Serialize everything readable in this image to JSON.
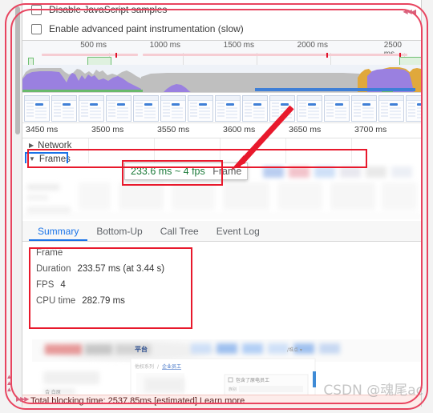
{
  "settings": {
    "checkboxes": [
      {
        "label": "Disable JavaScript samples",
        "checked": false
      },
      {
        "label": "Enable advanced paint instrumentation (slow)",
        "checked": false
      }
    ]
  },
  "overview": {
    "ticks": [
      "500 ms",
      "1000 ms",
      "1500 ms",
      "2000 ms",
      "2500 ms"
    ]
  },
  "timeline_ruler": {
    "ticks": [
      "3450 ms",
      "3500 ms",
      "3550 ms",
      "3600 ms",
      "3650 ms",
      "3700 ms"
    ]
  },
  "tracks": {
    "network_label": "Network",
    "network_triangle": "▶",
    "frames_label": "Frames",
    "frames_triangle": "▼",
    "frame_bar_label": "233.6 ms"
  },
  "tooltip": {
    "duration_fps": "233.6 ms ~ 4 fps",
    "kind": "Frame"
  },
  "tabs": [
    {
      "label": "Summary",
      "active": true
    },
    {
      "label": "Bottom-Up",
      "active": false
    },
    {
      "label": "Call Tree",
      "active": false
    },
    {
      "label": "Event Log",
      "active": false
    }
  ],
  "summary": {
    "title": "Frame",
    "rows": [
      {
        "label": "Duration",
        "value": "233.57 ms (at 3.44 s)"
      },
      {
        "label": "FPS",
        "value": "4"
      },
      {
        "label": "CPU time",
        "value": "282.79 ms"
      }
    ]
  },
  "status_bar": {
    "text": "Total blocking time: 2537.85ms [estimated]  Learn more"
  },
  "watermark": {
    "text": "CSDN @魂尾ac"
  },
  "annotations": {
    "chevrons_top": "◀◀◀",
    "chevrons_left": "▲▲▲",
    "chevrons_bottom": "▶▶▶"
  },
  "colors": {
    "accent_blue": "#1a73e8",
    "annotation_red": "#e8192c",
    "frame_teal": "#c7dcd4",
    "scripting_purple": "#9a80e0",
    "rendering_orange": "#e0a83c",
    "painting_green": "#69b96b",
    "system_gray": "#bfbfbf",
    "network_pink": "#f6cdd3"
  }
}
